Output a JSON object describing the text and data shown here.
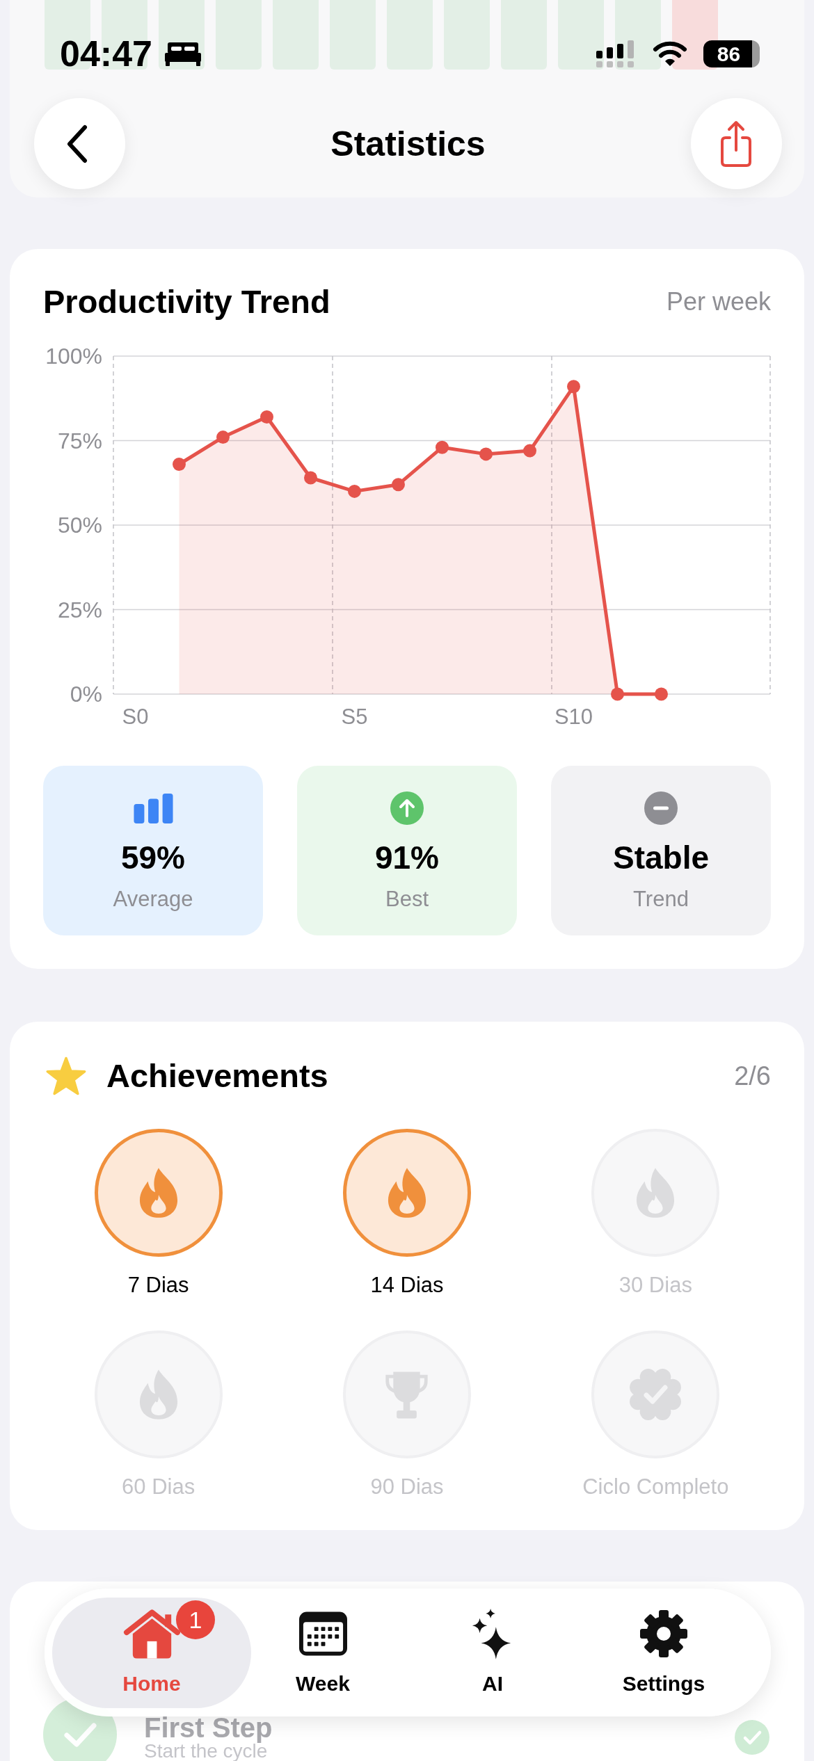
{
  "status_bar": {
    "time": "04:47",
    "battery": "86"
  },
  "background_chart": {
    "bars": [
      {
        "kind": "completed"
      },
      {
        "kind": "completed"
      },
      {
        "kind": "completed"
      },
      {
        "kind": "completed"
      },
      {
        "kind": "completed"
      },
      {
        "kind": "completed"
      },
      {
        "kind": "completed"
      },
      {
        "kind": "completed"
      },
      {
        "kind": "completed"
      },
      {
        "kind": "completed"
      },
      {
        "kind": "completed"
      },
      {
        "kind": "current"
      }
    ]
  },
  "header": {
    "title": "Statistics"
  },
  "trend": {
    "title": "Productivity Trend",
    "period": "Per week",
    "chart_data": {
      "type": "area",
      "grid": true,
      "categories": [
        "S0",
        null,
        null,
        null,
        null,
        "S5",
        null,
        null,
        null,
        null,
        "S10",
        null,
        null,
        null,
        null
      ],
      "ylim": [
        0,
        100
      ],
      "yticks": [
        {
          "value": 0,
          "label": "0%"
        },
        {
          "value": 25,
          "label": "25%"
        },
        {
          "value": 50,
          "label": "50%"
        },
        {
          "value": 75,
          "label": "75%"
        },
        {
          "value": 100,
          "label": "100%"
        }
      ],
      "series": [
        {
          "color": "#e5534b",
          "values": [
            null,
            68,
            76,
            82,
            64,
            60,
            62,
            73,
            71,
            72,
            91,
            0,
            0,
            null,
            null
          ]
        }
      ]
    },
    "stats": [
      {
        "kind": "average",
        "value": "59%",
        "label": "Average"
      },
      {
        "kind": "best",
        "value": "91%",
        "label": "Best"
      },
      {
        "kind": "trend",
        "value": "Stable",
        "label": "Trend"
      }
    ]
  },
  "achievements": {
    "title": "Achievements",
    "count": "2/6",
    "items": [
      {
        "kind": "flame",
        "label": "7 Dias",
        "unlocked": true
      },
      {
        "kind": "flame",
        "label": "14 Dias",
        "unlocked": true
      },
      {
        "kind": "flame",
        "label": "30 Dias",
        "unlocked": false
      },
      {
        "kind": "flame",
        "label": "60 Dias",
        "unlocked": false
      },
      {
        "kind": "trophy",
        "label": "90 Dias",
        "unlocked": false
      },
      {
        "kind": "seal",
        "label": "Ciclo Completo",
        "unlocked": false
      }
    ]
  },
  "milestones": {
    "items": [
      {
        "title": "First Step",
        "subtitle": "Start the cycle",
        "done": true
      }
    ]
  },
  "tab_bar": {
    "tabs": [
      {
        "label": "Home",
        "selected": true,
        "badge": "1"
      },
      {
        "label": "Week",
        "selected": false
      },
      {
        "label": "AI",
        "selected": false
      },
      {
        "label": "Settings",
        "selected": false
      }
    ]
  }
}
